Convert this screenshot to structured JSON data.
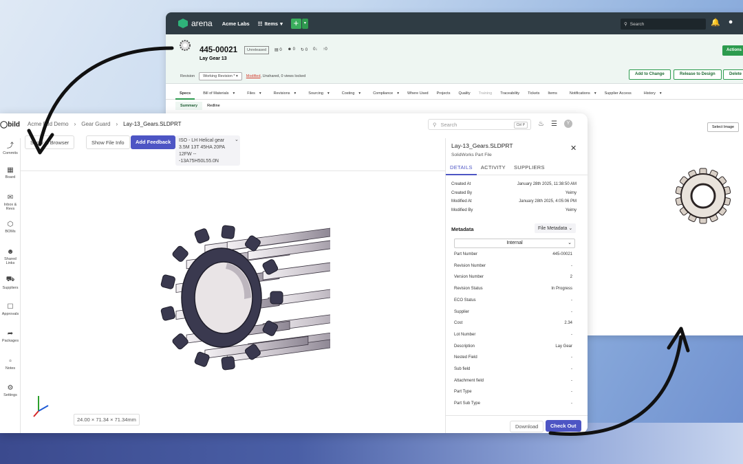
{
  "arena": {
    "brand": "arena",
    "org": "Acme Labs",
    "items_menu": "Items",
    "search_placeholder": "Search",
    "part_number": "445-00021",
    "status_badge": "Unreleased",
    "stats": [
      "0",
      "0",
      "0",
      "0",
      "0"
    ],
    "part_name": "Lay Gear 13",
    "actions_label": "Actions",
    "revision_label": "Revision",
    "working_revision": "Working Revision *",
    "modified": "Modified",
    "revision_status_rest": ", Unshared, 0 views locked",
    "add_to_change": "Add to Change",
    "release_to_design": "Release to Design",
    "delete_label": "Delete",
    "tabs": [
      "Specs",
      "Bill of Materials",
      "Files",
      "Revisions",
      "Sourcing",
      "Costing",
      "Compliance",
      "Where Used",
      "Projects",
      "Quality",
      "Training",
      "Traceability",
      "Tickets",
      "Items",
      "Notifications",
      "Supplier Access",
      "History"
    ],
    "subtabs": [
      "Summary",
      "Redline"
    ],
    "select_image": "Select Image"
  },
  "bild": {
    "logo": "bild",
    "breadcrumb": [
      "Acme Bild Demo",
      "Gear Guard",
      "Lay-13_Gears.SLDPRT"
    ],
    "search_placeholder": "Search",
    "search_shortcut": "Ctrl P",
    "avatar_initial": "Y",
    "sidebar": [
      {
        "label": "Commits",
        "icon": "commit-icon"
      },
      {
        "label": "Board",
        "icon": "board-icon"
      },
      {
        "label": "Inbox & Revs",
        "icon": "inbox-icon"
      },
      {
        "label": "BOMs",
        "icon": "cube-icon"
      },
      {
        "label": "Shared Links",
        "icon": "users-icon"
      },
      {
        "label": "Suppliers",
        "icon": "truck-icon"
      },
      {
        "label": "Approvals",
        "icon": "clipboard-icon"
      },
      {
        "label": "Packages",
        "icon": "share-icon"
      },
      {
        "label": "Notes",
        "icon": "note-icon"
      },
      {
        "label": "Settings",
        "icon": "gear-icon"
      }
    ],
    "toolbar": {
      "browser": "Show in Browser",
      "file_info": "Show File Info",
      "feedback": "Add Feedback"
    },
    "iso_lines": [
      "ISO - LH Helical gear",
      "3.5M 13T 45HA 20PA",
      "12FW --",
      "-13A75H50L55.0N"
    ],
    "dimensions": "24.00 × 71.34 × 71.34mm",
    "panel": {
      "title": "Lay-13_Gears.SLDPRT",
      "subtitle": "SolidWorks Part File",
      "tabs": [
        "DETAILS",
        "ACTIVITY",
        "SUPPLIERS"
      ],
      "details": [
        {
          "k": "Created At",
          "v": "January 28th 2025, 11:38:50 AM"
        },
        {
          "k": "Created By",
          "v": "Yeimy"
        },
        {
          "k": "Modified At",
          "v": "January 28th 2025, 4:05:06 PM"
        },
        {
          "k": "Modified By",
          "v": "Yeimy"
        }
      ],
      "metadata_title": "Metadata",
      "metadata_dropdown": "File Metadata",
      "internal": "Internal",
      "metadata": [
        {
          "k": "Part Number",
          "v": "445-00021"
        },
        {
          "k": "Revision Number",
          "v": "-"
        },
        {
          "k": "Version Number",
          "v": "2"
        },
        {
          "k": "Revision Status",
          "v": "In Progress"
        },
        {
          "k": "ECO Status",
          "v": "-"
        },
        {
          "k": "Supplier",
          "v": "-"
        },
        {
          "k": "Cost",
          "v": "2.34"
        },
        {
          "k": "Lot Number",
          "v": "-"
        },
        {
          "k": "Description",
          "v": "Lay Gear"
        },
        {
          "k": "Nested Field",
          "v": "-"
        },
        {
          "k": "Sub field",
          "v": "-"
        },
        {
          "k": "Attachment field",
          "v": "-"
        },
        {
          "k": "Part Type",
          "v": "-"
        },
        {
          "k": "Part Sub Type",
          "v": "-"
        }
      ],
      "download": "Download",
      "checkout": "Check Out"
    }
  },
  "colors": {
    "accent": "#4d55c4",
    "arena_green": "#2c9b4e",
    "arena_dark": "#2f3c44"
  }
}
